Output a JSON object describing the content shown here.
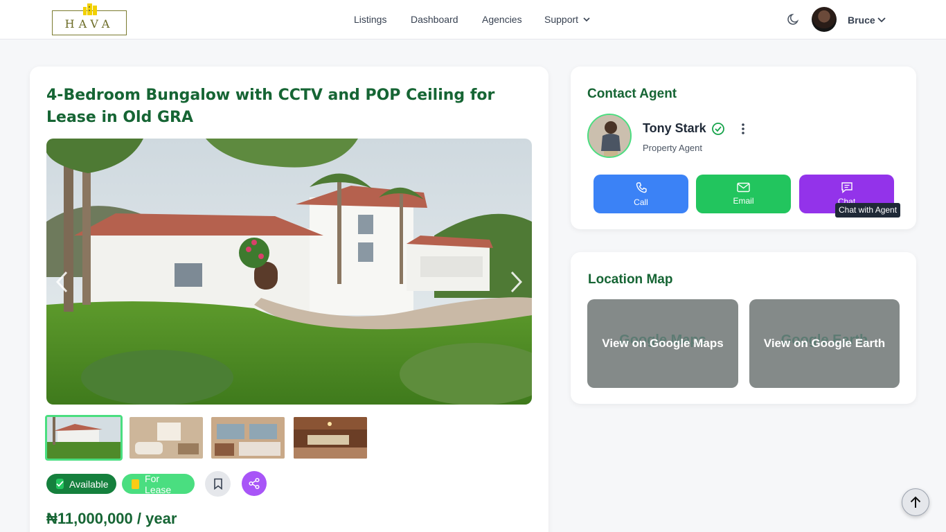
{
  "header": {
    "logo_text": "HAVA",
    "nav": {
      "listings": "Listings",
      "dashboard": "Dashboard",
      "agencies": "Agencies",
      "support": "Support"
    },
    "user_name": "Bruce",
    "icons": [
      "moon-icon",
      "chevron-down-icon"
    ]
  },
  "listing": {
    "title": "4-Bedroom Bungalow with CCTV and POP Ceiling for Lease in Old GRA",
    "status_badge": "Available",
    "type_badge": "For Lease",
    "price": "₦11,000,000 / year",
    "thumbnail_count": 4
  },
  "contact": {
    "title": "Contact Agent",
    "agent_name": "Tony Stark",
    "agent_role": "Property Agent",
    "buttons": {
      "call": "Call",
      "email": "Email",
      "chat": "Chat"
    },
    "tooltip": "Chat with Agent"
  },
  "location": {
    "title": "Location Map",
    "google_maps_ghost": "Google Maps",
    "google_maps": "View on Google Maps",
    "google_earth_ghost": "Google Earth",
    "google_earth": "View on Google Earth"
  },
  "colors": {
    "brand_green": "#166534",
    "call": "#3b82f6",
    "email": "#22c55e",
    "chat": "#9333ea",
    "share": "#a855f7"
  }
}
